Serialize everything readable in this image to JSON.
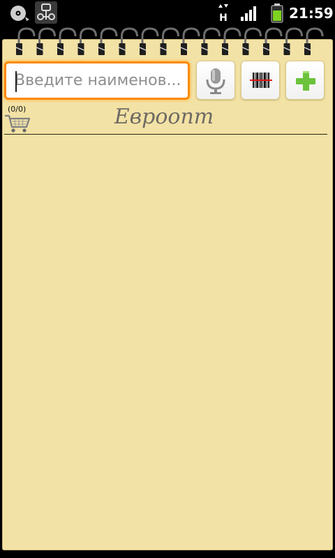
{
  "status_bar": {
    "time": "21:59",
    "network_type": "H",
    "icons": [
      "disc-icon",
      "app-notification-icon",
      "network-activity-icon",
      "signal-icon",
      "battery-icon"
    ]
  },
  "toolbar": {
    "search_placeholder": "Введите наименов...",
    "search_value": "",
    "mic_icon": "microphone-icon",
    "barcode_icon": "barcode-icon",
    "add_icon": "plus-icon"
  },
  "list": {
    "title": "Евроопт",
    "cart_count": "(0/0)",
    "items": []
  },
  "colors": {
    "paper": "#f3e2a5",
    "focus": "#ff8a00",
    "add_green": "#6cc23b",
    "title": "#6e6a64"
  }
}
